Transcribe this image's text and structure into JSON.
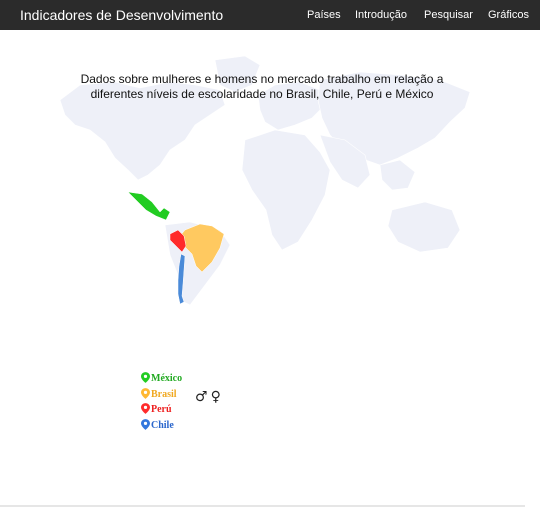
{
  "header": {
    "brand": "Indicadores de Desenvolvimento",
    "nav": [
      "Países",
      "Introdução",
      "Pesquisar",
      "Gráficos"
    ]
  },
  "map": {
    "title": "Dados sobre mulheres e homens no mercado trabalho em relação a diferentes níveis de escolaridade no Brasil, Chile, Perú e México",
    "highlighted_countries": [
      "México",
      "Brasil",
      "Perú",
      "Chile"
    ]
  },
  "legend": {
    "items": [
      {
        "label": "México",
        "color": "#22cc22"
      },
      {
        "label": "Brasil",
        "color": "#ffb833"
      },
      {
        "label": "Perú",
        "color": "#ff2b2b"
      },
      {
        "label": "Chile",
        "color": "#3377dd"
      }
    ]
  },
  "gender_icons": {
    "male": "♂",
    "female": "♀"
  },
  "colors": {
    "header_bg": "#2b2b2b",
    "land": "#eef0f8",
    "borders": "#ffffff"
  }
}
